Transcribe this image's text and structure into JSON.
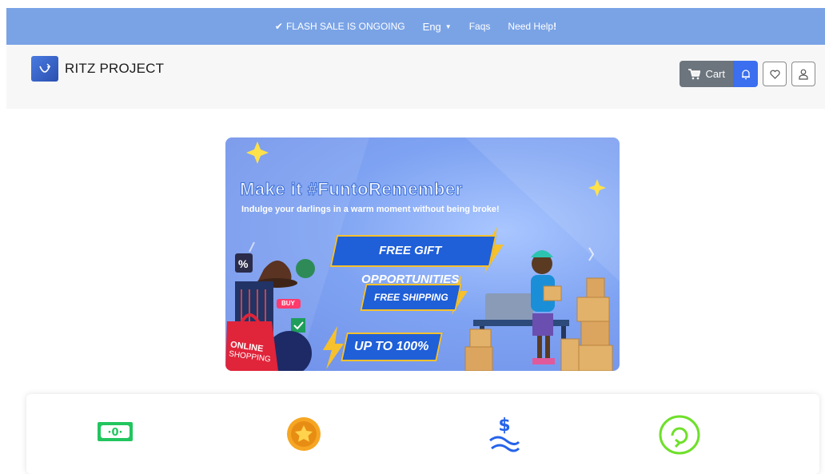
{
  "topbar": {
    "sale_text": "FLASH SALE IS ONGOING",
    "language": "Eng",
    "faqs": "Faqs",
    "help": "Need Help",
    "help_mark": "!",
    "background": "#7aa3e6"
  },
  "brand": {
    "name": "RITZ PROJECT"
  },
  "actions": {
    "cart_label": "Cart",
    "cart_color": "#6c757d",
    "bell_color": "#3b6ff0"
  },
  "banner": {
    "headline": "Make it #FuntoRemember",
    "subline": "Indulge your darlings in a warm moment without being broke!",
    "ribbon_1": "FREE GIFT OPPORTUNITIES",
    "ribbon_2": "FREE SHIPPING",
    "ribbon_3": "UP TO 100%",
    "bag_line1": "ONLINE",
    "bag_line2": "SHOPPING",
    "tag_percent": "%",
    "tag_buy": "BUY"
  },
  "features": {
    "icons": [
      "cash-icon",
      "coin-star-icon",
      "dollar-hand-icon",
      "refresh-icon"
    ]
  }
}
